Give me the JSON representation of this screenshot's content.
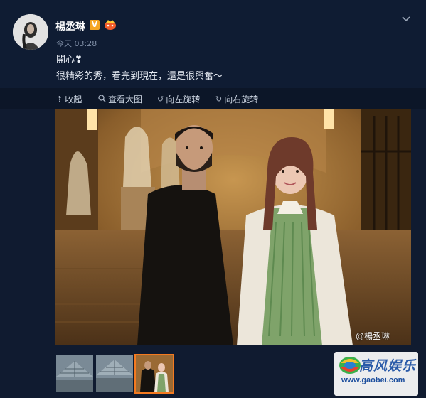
{
  "post": {
    "username": "楊丞琳",
    "verified_badge": "V",
    "timestamp": "今天 03:28",
    "line1": "開心❣",
    "line2": "很精彩的秀，看完到現在，還是很興奮～"
  },
  "toolbar": {
    "collapse": "收起",
    "view_large": "查看大图",
    "rotate_left": "向左旋转",
    "rotate_right": "向右旋转"
  },
  "photo": {
    "watermark": "@楊丞琳"
  },
  "thumbnails": [
    {
      "name": "thumb-1",
      "active": false
    },
    {
      "name": "thumb-2",
      "active": false
    },
    {
      "name": "thumb-3",
      "active": true
    }
  ],
  "logo": {
    "text": "高风娱乐",
    "url": "www.gaobei.com"
  },
  "colors": {
    "background": "#101b30",
    "accent_orange": "#f47a20",
    "verified_yellow": "#f6a623"
  },
  "icons": [
    "chevron-down-icon",
    "collapse-icon",
    "magnifier-icon",
    "rotate-left-icon",
    "rotate-right-icon"
  ]
}
